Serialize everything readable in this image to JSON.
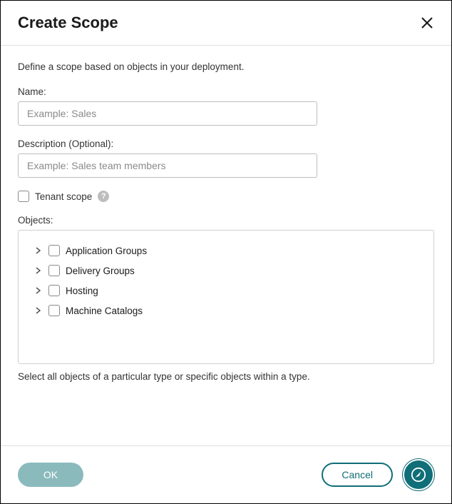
{
  "header": {
    "title": "Create Scope"
  },
  "body": {
    "intro": "Define a scope based on objects in your deployment.",
    "name_label": "Name:",
    "name_placeholder": "Example: Sales",
    "desc_label": "Description (Optional):",
    "desc_placeholder": "Example: Sales team members",
    "tenant_label": "Tenant scope",
    "objects_label": "Objects:",
    "objects": [
      {
        "label": "Application Groups"
      },
      {
        "label": "Delivery Groups"
      },
      {
        "label": "Hosting"
      },
      {
        "label": "Machine Catalogs"
      }
    ],
    "helper": "Select all objects of a particular type or specific objects within a type."
  },
  "footer": {
    "ok": "OK",
    "cancel": "Cancel"
  }
}
